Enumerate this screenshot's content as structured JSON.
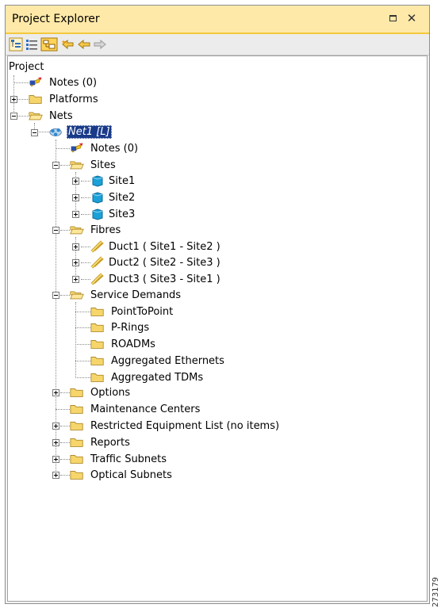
{
  "panel": {
    "title": "Project Explorer",
    "close_glyph": "✕"
  },
  "tree": {
    "root_label": "Project",
    "nodes": [
      {
        "label": "Notes (0)",
        "icon": "notes-icon"
      },
      {
        "label": "Platforms",
        "icon": "folder-icon",
        "expander": "plus"
      },
      {
        "label": "Nets",
        "icon": "folder-open-icon",
        "expander": "minus"
      },
      {
        "label": "Net1 [L]",
        "icon": "network-icon",
        "expander": "minus",
        "selected": true
      },
      {
        "label": "Notes (0)",
        "icon": "notes-icon"
      },
      {
        "label": "Sites",
        "icon": "folder-open-icon",
        "expander": "minus"
      },
      {
        "label": "Site1",
        "icon": "site-icon",
        "expander": "plus"
      },
      {
        "label": "Site2",
        "icon": "site-icon",
        "expander": "plus"
      },
      {
        "label": "Site3",
        "icon": "site-icon",
        "expander": "plus"
      },
      {
        "label": "Fibres",
        "icon": "folder-open-icon",
        "expander": "minus"
      },
      {
        "label": "Duct1 ( Site1 - Site2 )",
        "icon": "fibre-duct-icon",
        "expander": "plus"
      },
      {
        "label": "Duct2 ( Site2 - Site3 )",
        "icon": "fibre-duct-icon",
        "expander": "plus"
      },
      {
        "label": "Duct3 ( Site3 - Site1 )",
        "icon": "fibre-duct-icon",
        "expander": "plus"
      },
      {
        "label": "Service Demands",
        "icon": "folder-open-icon",
        "expander": "minus"
      },
      {
        "label": "PointToPoint",
        "icon": "folder-icon"
      },
      {
        "label": "P-Rings",
        "icon": "folder-icon"
      },
      {
        "label": "ROADMs",
        "icon": "folder-icon"
      },
      {
        "label": "Aggregated Ethernets",
        "icon": "folder-icon"
      },
      {
        "label": "Aggregated TDMs",
        "icon": "folder-icon"
      },
      {
        "label": "Options",
        "icon": "folder-icon",
        "expander": "plus"
      },
      {
        "label": "Maintenance Centers",
        "icon": "folder-icon"
      },
      {
        "label": "Restricted Equipment List (no items)",
        "icon": "folder-icon",
        "expander": "plus"
      },
      {
        "label": "Reports",
        "icon": "folder-icon",
        "expander": "plus"
      },
      {
        "label": "Traffic Subnets",
        "icon": "folder-icon",
        "expander": "plus"
      },
      {
        "label": "Optical Subnets",
        "icon": "folder-icon",
        "expander": "plus"
      }
    ]
  },
  "figure_id": "273179",
  "colors": {
    "title_bg": "#ffe9a8",
    "folder": "#f6d66b",
    "selection": "#1a3b8a",
    "site": "#1ba0d8"
  }
}
